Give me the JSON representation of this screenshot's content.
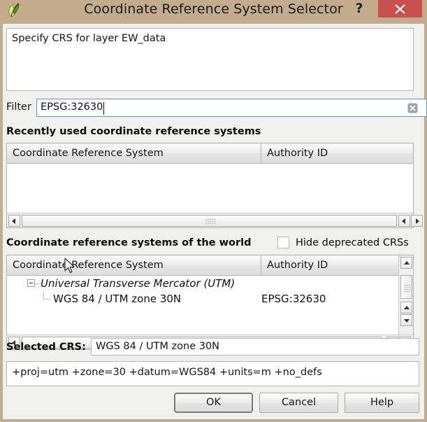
{
  "window": {
    "title": "Coordinate Reference System Selector",
    "app_icon": "qgis-leaf-icon",
    "help_symbol": "?",
    "close_symbol": "✕"
  },
  "description": {
    "text": "Specify CRS for layer EW_data"
  },
  "filter": {
    "label": "Filter",
    "value": "EPSG:32630",
    "placeholder": "",
    "clear_icon": "clear-x-icon"
  },
  "recent": {
    "title": "Recently used coordinate reference systems",
    "columns": [
      "Coordinate Reference System",
      "Authority ID"
    ],
    "rows": []
  },
  "world": {
    "title": "Coordinate reference systems of the world",
    "hide_deprecated_label": "Hide deprecated CRSs",
    "hide_deprecated_checked": false,
    "columns": [
      "Coordinate Reference System",
      "Authority ID"
    ],
    "rows": [
      {
        "name": "Universal Transverse Mercator (UTM)",
        "authority": "",
        "level": 0,
        "expanded": true
      },
      {
        "name": "WGS 84 / UTM zone 30N",
        "authority": "EPSG:32630",
        "level": 1,
        "expanded": false
      }
    ]
  },
  "selected": {
    "label": "Selected CRS:",
    "value": "WGS 84 / UTM zone 30N",
    "proj_string": "+proj=utm +zone=30 +datum=WGS84 +units=m +no_defs"
  },
  "buttons": {
    "ok": "OK",
    "cancel": "Cancel",
    "help": "Help"
  },
  "colors": {
    "titlebar": "#c3ab8e",
    "close_button": "#c8504f",
    "focus_border": "#5b9bd5",
    "client_background": "#f0f0ee"
  }
}
